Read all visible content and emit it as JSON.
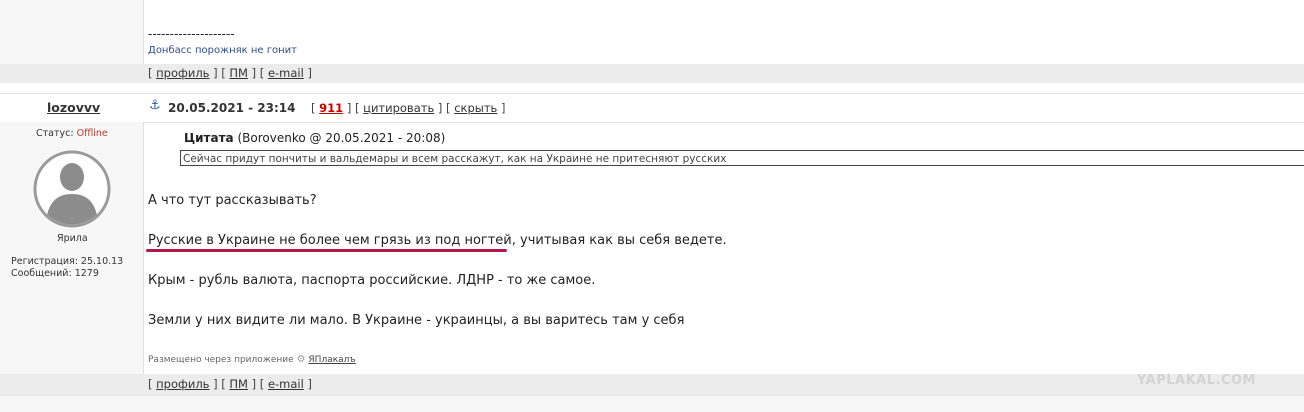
{
  "top_post": {
    "signature_line": "--------------------",
    "signature_text": "Донбасс порожняк не гонит",
    "links": {
      "open": "[",
      "profile": "профиль",
      "sep1": "] [",
      "pm": "ПМ",
      "sep2": "] [",
      "email": "e-mail",
      "close": "]"
    }
  },
  "post": {
    "username": "lozovvv",
    "anchor_icon": "anchor-icon",
    "date": "20.05.2021 - 23:14",
    "actions": {
      "open": "[",
      "rating": "911",
      "sep1": "] [",
      "quote": "цитировать",
      "sep2": "] [",
      "hide": "скрыть",
      "close": "]"
    },
    "status_label": "Статус:",
    "status_value": "Offline",
    "avatar_icon": "user-avatar-icon",
    "rank": "Ярила",
    "registration": "Регистрация: 25.10.13",
    "messages": "Сообщений: 1279",
    "quote": {
      "label": "Цитата",
      "meta": "(Borovenko @ 20.05.2021 - 20:08)",
      "text": "Сейчас придут пончиты и вальдемары и всем расскажут, как на Украине не притесняют русских"
    },
    "paragraphs": {
      "p1": "А что тут рассказывать?",
      "p2_underlined": "Русские в Украине не более чем грязь из под ногтей",
      "p2_rest": ", учитывая как вы себя ведете.",
      "p3": "Крым - рубль валюта, паспорта российские. ЛДНР - то же самое.",
      "p4": "Земли у них видите ли мало. В Украине - украинцы, а вы варитесь там у себя"
    },
    "app_note": "Размещено через приложение",
    "app_link": "ЯПлакалъ",
    "links": {
      "open": "[",
      "profile": "профиль",
      "sep1": "] [",
      "pm": "ПМ",
      "sep2": "] [",
      "email": "e-mail",
      "close": "]"
    }
  },
  "watermark": "YAPLAKAL.COM",
  "colors": {
    "accent_red": "#c00",
    "underline": "#b3174a",
    "offline": "#c0392b"
  }
}
